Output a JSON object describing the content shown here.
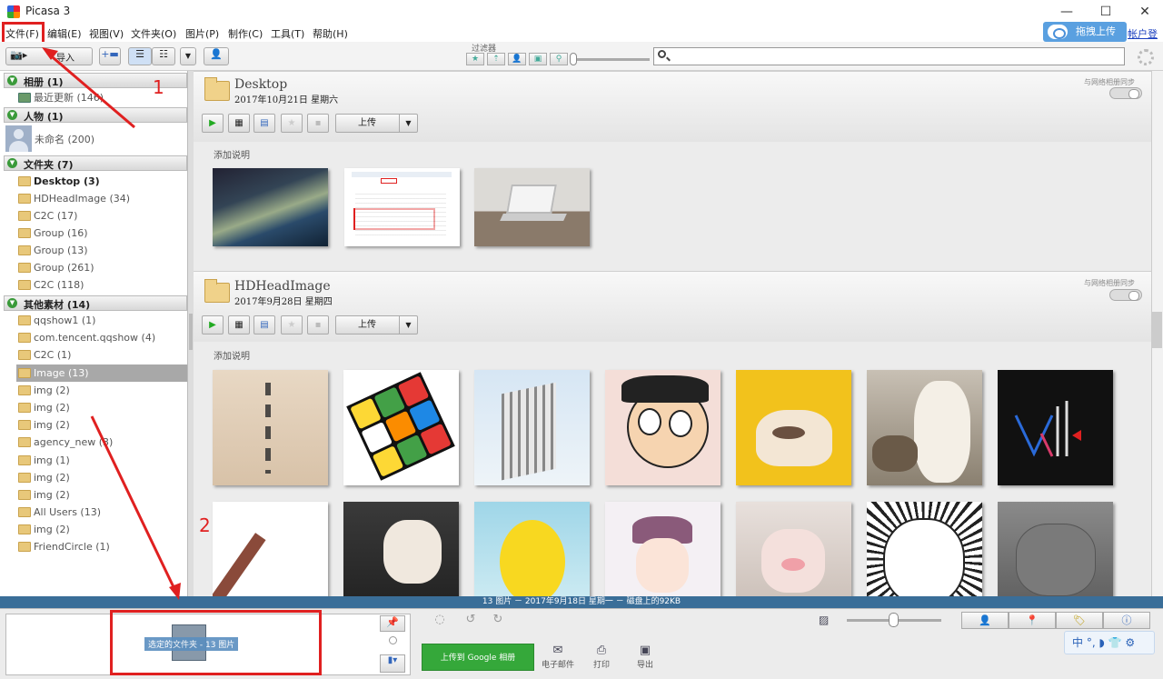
{
  "window": {
    "title": "Picasa 3",
    "minimize": "—",
    "maximize": "☐",
    "close": "✕"
  },
  "menu": [
    "文件(F)",
    "编辑(E)",
    "视图(V)",
    "文件夹(O)",
    "图片(P)",
    "制作(C)",
    "工具(T)",
    "帮助(H)"
  ],
  "header": {
    "upload_button": "拖拽上传",
    "login_link": "帐户登录"
  },
  "toolbar": {
    "import_label": "导入",
    "filter_label": "过滤器",
    "search_placeholder": ""
  },
  "sidebar": {
    "sections": [
      {
        "label": "相册 (1)"
      },
      {
        "label": "人物 (1)"
      },
      {
        "label": "文件夹 (7)"
      },
      {
        "label": "其他素材 (14)"
      }
    ],
    "albums": [
      {
        "label": "最近更新 (146)"
      }
    ],
    "people": [
      {
        "label": "未命名 (200)"
      }
    ],
    "folders": [
      {
        "label": "Desktop (3)"
      },
      {
        "label": "HDHeadImage (34)"
      },
      {
        "label": "C2C (17)"
      },
      {
        "label": "Group (16)"
      },
      {
        "label": "Group (13)"
      },
      {
        "label": "Group (261)"
      },
      {
        "label": "C2C (118)"
      }
    ],
    "other": [
      {
        "label": "qqshow1 (1)"
      },
      {
        "label": "com.tencent.qqshow (4)"
      },
      {
        "label": "C2C (1)"
      },
      {
        "label": "Image (13)",
        "selected": true
      },
      {
        "label": "img (2)"
      },
      {
        "label": "img (2)"
      },
      {
        "label": "img (2)"
      },
      {
        "label": "agency_new (3)"
      },
      {
        "label": "img (1)"
      },
      {
        "label": "img (2)"
      },
      {
        "label": "img (2)"
      },
      {
        "label": "All Users (13)"
      },
      {
        "label": "img (2)"
      },
      {
        "label": "FriendCircle (1)"
      }
    ]
  },
  "annotations": {
    "one": "1",
    "two": "2"
  },
  "albums": [
    {
      "title": "Desktop",
      "date": "2017年10月21日 星期六",
      "sync": "与网络相册同步",
      "upload": "上传",
      "caption": "添加说明"
    },
    {
      "title": "HDHeadImage",
      "date": "2017年9月28日 星期四",
      "sync": "与网络相册同步",
      "upload": "上传",
      "caption": "添加说明"
    }
  ],
  "rubik_colors": [
    "#e53935",
    "#43a047",
    "#fdd835",
    "#1e88e5",
    "#fb8c00",
    "#ffffff"
  ],
  "status": {
    "text": "13 图片  －  2017年9月18日 星期一  －  磁盘上的92KB"
  },
  "tray": {
    "selection_label": "选定的文件夹 - 13 图片",
    "google_upload": "上传到 Google 相册",
    "email": "电子邮件",
    "print": "打印",
    "export": "导出",
    "ime": "中 °, ◗ 👕 ⚙"
  },
  "colors": {
    "annotation_red": "#e02020",
    "status_blue": "#3a6e98",
    "upload_green": "#35a83a",
    "accent_blue": "#5aa0e0"
  }
}
